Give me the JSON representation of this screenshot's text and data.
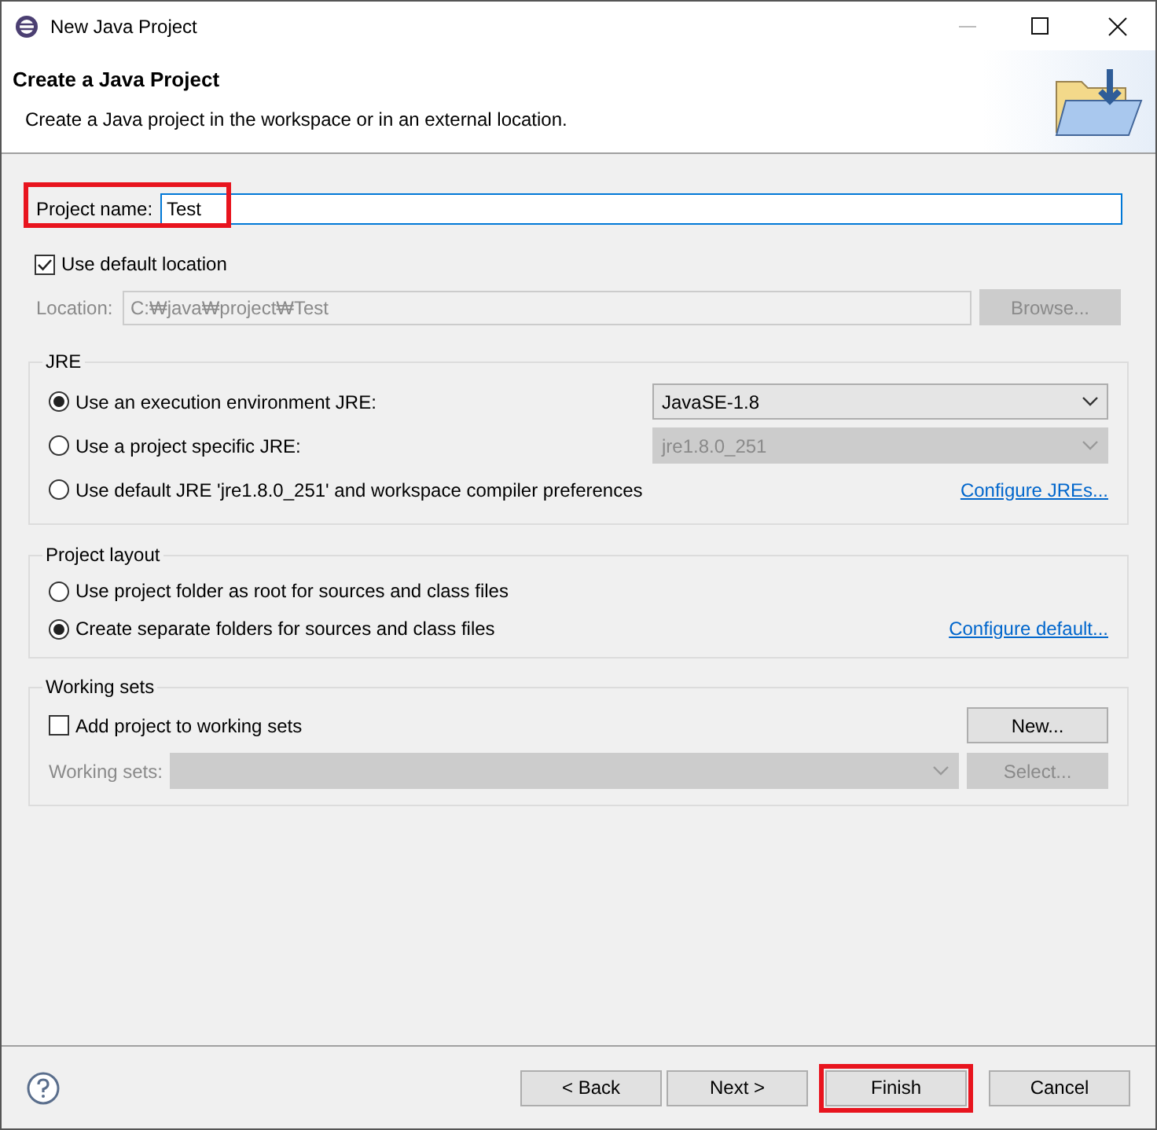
{
  "window": {
    "title": "New Java Project"
  },
  "header": {
    "title": "Create a Java Project",
    "description": "Create a Java project in the workspace or in an external location."
  },
  "project_name": {
    "label": "Project name:",
    "value": "Test",
    "highlighted": true
  },
  "use_default_location": {
    "label": "Use default location",
    "checked": true
  },
  "location": {
    "label": "Location:",
    "value": "C:₩java₩project₩Test",
    "disabled": true,
    "button": "Browse..."
  },
  "jre": {
    "title": "JRE",
    "options": [
      {
        "label": "Use an execution environment JRE:",
        "selected": true,
        "dropdown": {
          "value": "JavaSE-1.8",
          "disabled": false
        }
      },
      {
        "label": "Use a project specific JRE:",
        "selected": false,
        "dropdown": {
          "value": "jre1.8.0_251",
          "disabled": true
        }
      },
      {
        "label": "Use default JRE 'jre1.8.0_251' and workspace compiler preferences",
        "selected": false,
        "link": "Configure JREs..."
      }
    ]
  },
  "project_layout": {
    "title": "Project layout",
    "options": [
      {
        "label": "Use project folder as root for sources and class files",
        "selected": false
      },
      {
        "label": "Create separate folders for sources and class files",
        "selected": true,
        "link": "Configure default..."
      }
    ]
  },
  "working_sets": {
    "title": "Working sets",
    "checkbox": {
      "label": "Add project to working sets",
      "checked": false
    },
    "new_button": "New...",
    "field": {
      "label": "Working sets:",
      "disabled": true
    },
    "select_button": {
      "label": "Select...",
      "disabled": true
    }
  },
  "buttons": [
    {
      "label": "< Back",
      "disabled": false,
      "highlighted": false
    },
    {
      "label": "Next >",
      "disabled": false,
      "highlighted": false
    },
    {
      "label": "Finish",
      "disabled": false,
      "highlighted": true
    },
    {
      "label": "Cancel",
      "disabled": false,
      "highlighted": false
    }
  ]
}
